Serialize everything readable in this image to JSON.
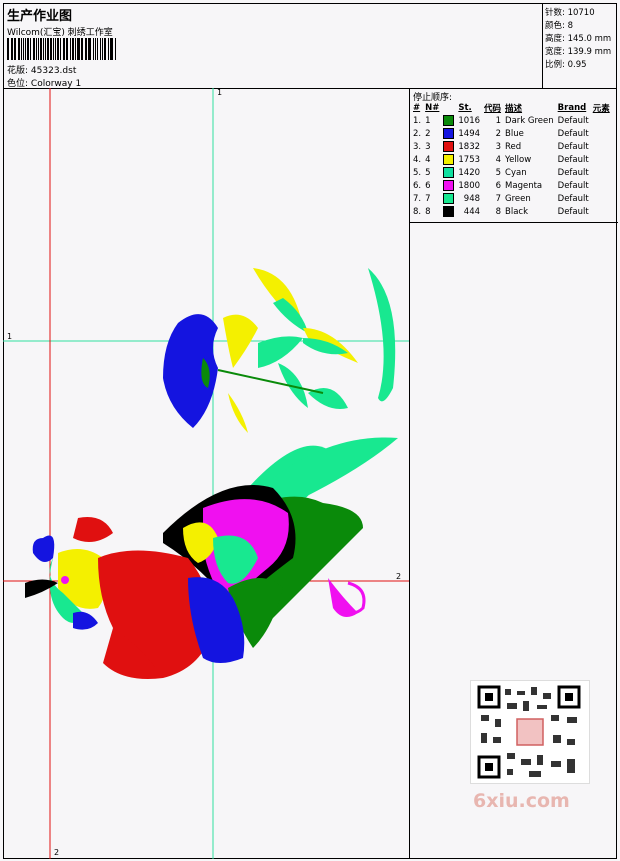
{
  "header": {
    "title": "生产作业图",
    "company": "Wilcom(汇宝) 刺绣工作室",
    "pattern_label": "花版:",
    "pattern_value": "45323.dst",
    "colorway_label": "色位:",
    "colorway_value": "Colorway 1"
  },
  "stats": {
    "stitches_label": "针数:",
    "stitches_value": "10710",
    "colors_label": "颜色:",
    "colors_value": "8",
    "height_label": "高度:",
    "height_value": "145.0 mm",
    "width_label": "宽度:",
    "width_value": "139.9 mm",
    "scale_label": "比例:",
    "scale_value": "0.95"
  },
  "stop_sequence": {
    "title": "停止顺序:",
    "headers": [
      "#",
      "N#",
      "",
      "St.",
      "代码",
      "描述",
      "Brand",
      "元素"
    ],
    "rows": [
      {
        "idx": "1.",
        "n": "1",
        "color": "#0a8a0a",
        "st": "1016",
        "code": "1",
        "desc": "Dark Green",
        "brand": "Default"
      },
      {
        "idx": "2.",
        "n": "2",
        "color": "#1414e0",
        "st": "1494",
        "code": "2",
        "desc": "Blue",
        "brand": "Default"
      },
      {
        "idx": "3.",
        "n": "3",
        "color": "#e01010",
        "st": "1832",
        "code": "3",
        "desc": "Red",
        "brand": "Default"
      },
      {
        "idx": "4.",
        "n": "4",
        "color": "#f4f000",
        "st": "1753",
        "code": "4",
        "desc": "Yellow",
        "brand": "Default"
      },
      {
        "idx": "5.",
        "n": "5",
        "color": "#10e0a0",
        "st": "1420",
        "code": "5",
        "desc": "Cyan",
        "brand": "Default"
      },
      {
        "idx": "6.",
        "n": "6",
        "color": "#f010f0",
        "st": "1800",
        "code": "6",
        "desc": "Magenta",
        "brand": "Default"
      },
      {
        "idx": "7.",
        "n": "7",
        "color": "#18e890",
        "st": "948",
        "code": "7",
        "desc": "Green",
        "brand": "Default"
      },
      {
        "idx": "8.",
        "n": "8",
        "color": "#000000",
        "st": "444",
        "code": "8",
        "desc": "Black",
        "brand": "Default"
      }
    ]
  },
  "axes": {
    "v1": "1",
    "h1": "1",
    "h2": "2",
    "v2": "2"
  },
  "watermark": "6xiu.com"
}
